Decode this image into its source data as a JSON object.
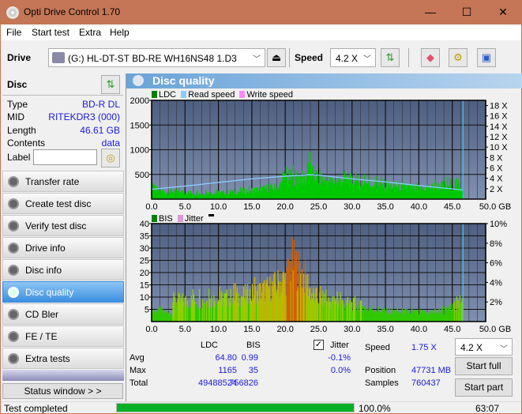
{
  "window": {
    "title": "Opti Drive Control 1.70",
    "minimize": "—",
    "maximize": "☐",
    "close": "✕"
  },
  "menu": [
    "File",
    "Start test",
    "Extra",
    "Help"
  ],
  "toolbar": {
    "drive_label": "Drive",
    "drive_value": "(G:)  HL-DT-ST BD-RE  WH16NS48 1.D3",
    "speed_label": "Speed",
    "speed_value": "4.2 X"
  },
  "disc": {
    "header": "Disc",
    "rows": [
      {
        "label": "Type",
        "value": "BD-R DL"
      },
      {
        "label": "MID",
        "value": "RITEKDR3 (000)"
      },
      {
        "label": "Length",
        "value": "46.61 GB"
      },
      {
        "label": "Contents",
        "value": "data"
      }
    ],
    "label_field": {
      "label": "Label",
      "value": ""
    }
  },
  "nav": [
    "Transfer rate",
    "Create test disc",
    "Verify test disc",
    "Drive info",
    "Disc info",
    "Disc quality",
    "CD Bler",
    "FE / TE",
    "Extra tests"
  ],
  "nav_active": "Disc quality",
  "status_window": "Status window > >",
  "panel": {
    "title": "Disc quality"
  },
  "chart_data": [
    {
      "type": "area",
      "legend": [
        "LDC",
        "Read speed",
        "Write speed"
      ],
      "colors": {
        "LDC": "#00c800",
        "Read speed": "#88ccff",
        "Write speed": "#ff88ff"
      },
      "x_ticks": [
        "0.0",
        "5.0",
        "10.0",
        "15.0",
        "20.0",
        "25.0",
        "30.0",
        "35.0",
        "40.0",
        "45.0",
        "50.0 GB"
      ],
      "y_ticks": [
        "2000",
        "1500",
        "1000",
        "500"
      ],
      "y2_ticks": [
        "18 X",
        "16 X",
        "14 X",
        "12 X",
        "10 X",
        "8 X",
        "6 X",
        "4 X",
        "2 X"
      ],
      "xlim": [
        0,
        50
      ],
      "ylim": [
        0,
        2000
      ],
      "y2lim": [
        0,
        19
      ],
      "ldc_envelope": [
        [
          0,
          300
        ],
        [
          1,
          250
        ],
        [
          2,
          200
        ],
        [
          3,
          220
        ],
        [
          5,
          200
        ],
        [
          7,
          160
        ],
        [
          10,
          180
        ],
        [
          13,
          220
        ],
        [
          15,
          250
        ],
        [
          17,
          300
        ],
        [
          19,
          350
        ],
        [
          20,
          600
        ],
        [
          22,
          650
        ],
        [
          23,
          500
        ],
        [
          23.5,
          1165
        ],
        [
          24,
          700
        ],
        [
          25,
          600
        ],
        [
          27,
          500
        ],
        [
          29,
          600
        ],
        [
          30,
          500
        ],
        [
          32,
          450
        ],
        [
          35,
          400
        ],
        [
          38,
          350
        ],
        [
          40,
          300
        ],
        [
          42,
          350
        ],
        [
          44,
          400
        ],
        [
          46,
          450
        ],
        [
          46.6,
          300
        ]
      ],
      "read_speed": [
        [
          0,
          1.9
        ],
        [
          5,
          2.5
        ],
        [
          10,
          3.2
        ],
        [
          15,
          3.9
        ],
        [
          20,
          4.4
        ],
        [
          23.5,
          4.7
        ],
        [
          25,
          4.6
        ],
        [
          30,
          3.9
        ],
        [
          35,
          3.3
        ],
        [
          40,
          2.6
        ],
        [
          46.6,
          1.75
        ]
      ],
      "end_marker": 46.61
    },
    {
      "type": "area",
      "legend": [
        "BIS",
        "Jitter"
      ],
      "colors": {
        "BIS": "#00c800",
        "Jitter": "#dd99dd"
      },
      "x_ticks": [
        "0.0",
        "5.0",
        "10.0",
        "15.0",
        "20.0",
        "25.0",
        "30.0",
        "35.0",
        "40.0",
        "45.0",
        "50.0 GB"
      ],
      "y_ticks": [
        "40",
        "35",
        "30",
        "25",
        "20",
        "15",
        "10",
        "5"
      ],
      "y2_ticks": [
        "10%",
        "8%",
        "6%",
        "4%",
        "2%"
      ],
      "xlim": [
        0,
        50
      ],
      "ylim": [
        0,
        40
      ],
      "bis_envelope": [
        [
          0,
          6
        ],
        [
          3,
          5
        ],
        [
          3.1,
          12
        ],
        [
          8,
          12
        ],
        [
          12,
          14
        ],
        [
          15,
          16
        ],
        [
          18,
          20
        ],
        [
          20,
          25
        ],
        [
          21,
          35
        ],
        [
          22,
          30
        ],
        [
          23,
          25
        ],
        [
          24,
          15
        ],
        [
          26,
          12
        ],
        [
          30,
          10
        ],
        [
          32,
          8
        ],
        [
          35,
          6
        ],
        [
          40,
          5
        ],
        [
          44,
          6
        ],
        [
          46,
          10
        ],
        [
          46.6,
          8
        ]
      ],
      "end_marker": 46.61
    }
  ],
  "stats": {
    "col_ldc": "LDC",
    "col_bis": "BIS",
    "rows": [
      {
        "label": "Avg",
        "ldc": "64.80",
        "bis": "0.99",
        "jitter": "-0.1%"
      },
      {
        "label": "Max",
        "ldc": "1165",
        "bis": "35",
        "jitter": "0.0%"
      },
      {
        "label": "Total",
        "ldc": "49488524",
        "bis": "756826"
      }
    ],
    "jitter_label": "Jitter",
    "jitter_checked": true,
    "speed_label": "Speed",
    "speed_value": "1.75 X",
    "position_label": "Position",
    "position_value": "47731 MB",
    "samples_label": "Samples",
    "samples_value": "760437",
    "speed_select": "4.2 X",
    "start_full": "Start full",
    "start_part": "Start part"
  },
  "statusbar": {
    "text": "Test completed",
    "progress": 100.0,
    "progress_text": "100.0%",
    "time": "63:07"
  }
}
